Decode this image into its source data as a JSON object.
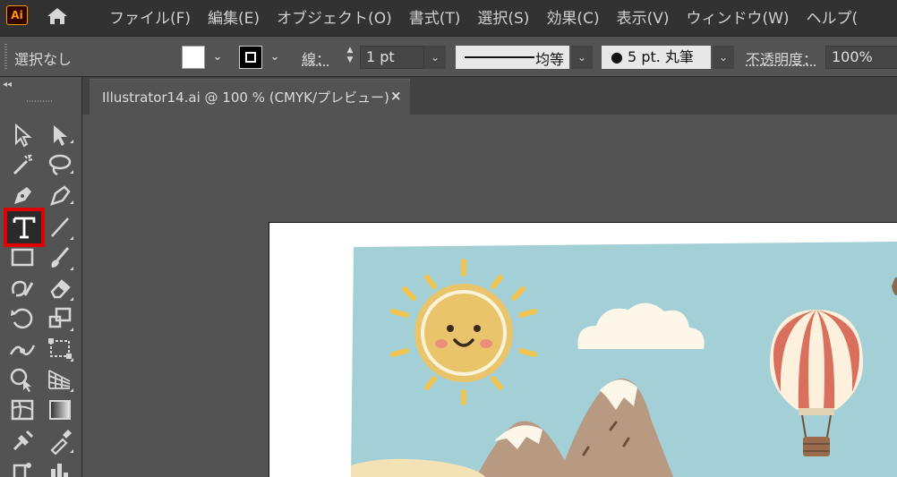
{
  "app": {
    "logo_text": "Ai",
    "menu": [
      "ファイル(F)",
      "編集(E)",
      "オブジェクト(O)",
      "書式(T)",
      "選択(S)",
      "効果(C)",
      "表示(V)",
      "ウィンドウ(W)",
      "ヘルプ("
    ]
  },
  "controlbar": {
    "selection": "選択なし",
    "stroke_label": "線：",
    "stroke_weight": "1 pt",
    "line_profile": "均等",
    "brush": "●  5 pt. 丸筆",
    "opacity_label": "不透明度：",
    "opacity": "100%",
    "fill_color": "#ffffff",
    "stroke_color": "#000000"
  },
  "document": {
    "tab_title": "Illustrator14.ai @ 100 % (CMYK/プレビュー)",
    "close_glyph": "×"
  },
  "toolbar": {
    "collapse_glyph": "◂◂",
    "selected_tool": "type-tool",
    "highlight_color": "#e10000"
  }
}
